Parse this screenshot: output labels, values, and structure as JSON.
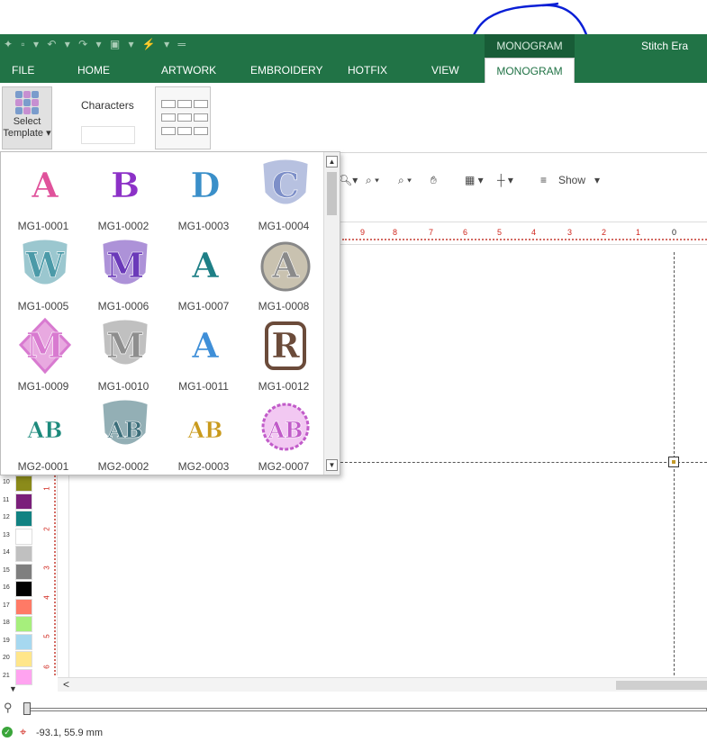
{
  "titlebar": {
    "context_title": "MONOGRAM",
    "app_title": "Stitch Era"
  },
  "tabs": [
    {
      "label": "FILE"
    },
    {
      "label": "HOME"
    },
    {
      "label": "ARTWORK"
    },
    {
      "label": "EMBROIDERY"
    },
    {
      "label": "HOTFIX"
    },
    {
      "label": "VIEW"
    },
    {
      "label": "MONOGRAM"
    }
  ],
  "ribbon": {
    "select_template_line1": "Select",
    "select_template_line2": "Template",
    "characters_label": "Characters",
    "characters_value": ""
  },
  "toolbar": {
    "show_label": "Show"
  },
  "ruler": {
    "ticks": [
      "9",
      "8",
      "7",
      "6",
      "5",
      "4",
      "3",
      "2",
      "1",
      "0"
    ]
  },
  "vruler": {
    "ticks": [
      "1",
      "2",
      "3",
      "4",
      "5",
      "6"
    ]
  },
  "gallery": {
    "items": [
      {
        "label": "MG1-0001",
        "glyph": "A",
        "color": "#e0529b"
      },
      {
        "label": "MG1-0002",
        "glyph": "B",
        "color": "#8c31c7"
      },
      {
        "label": "MG1-0003",
        "glyph": "D",
        "color": "#3a8fc9"
      },
      {
        "label": "MG1-0004",
        "glyph": "C",
        "color": "#7d8fc8"
      },
      {
        "label": "MG1-0005",
        "glyph": "W",
        "color": "#4b9aa8"
      },
      {
        "label": "MG1-0006",
        "glyph": "M",
        "color": "#6b3ab9"
      },
      {
        "label": "MG1-0007",
        "glyph": "A",
        "color": "#1e7f86"
      },
      {
        "label": "MG1-0008",
        "glyph": "A",
        "color": "#8a8a8a"
      },
      {
        "label": "MG1-0009",
        "glyph": "M",
        "color": "#d87ad0"
      },
      {
        "label": "MG1-0010",
        "glyph": "M",
        "color": "#8e8e8e"
      },
      {
        "label": "MG1-0011",
        "glyph": "A",
        "color": "#3f8fd8"
      },
      {
        "label": "MG1-0012",
        "glyph": "R",
        "color": "#6b4b3a"
      },
      {
        "label": "MG2-0001",
        "glyph": "AB",
        "color": "#1c8a7c"
      },
      {
        "label": "MG2-0002",
        "glyph": "AB",
        "color": "#3c6e7a"
      },
      {
        "label": "MG2-0003",
        "glyph": "AB",
        "color": "#c99a1c"
      },
      {
        "label": "MG2-0007",
        "glyph": "AB",
        "color": "#c15bc9"
      }
    ]
  },
  "palette": [
    {
      "num": "10",
      "color": "#8b8b1a"
    },
    {
      "num": "11",
      "color": "#7a1f7a"
    },
    {
      "num": "12",
      "color": "#128282"
    },
    {
      "num": "13",
      "color": "#ffffff"
    },
    {
      "num": "14",
      "color": "#c0c0c0"
    },
    {
      "num": "15",
      "color": "#7f7f7f"
    },
    {
      "num": "16",
      "color": "#000000"
    },
    {
      "num": "17",
      "color": "#ff7a66"
    },
    {
      "num": "18",
      "color": "#a6ef7c"
    },
    {
      "num": "19",
      "color": "#a6d8f0"
    },
    {
      "num": "20",
      "color": "#ffe68a"
    },
    {
      "num": "21",
      "color": "#ffa3f0"
    }
  ],
  "status": {
    "coordinates": "-93.1, 55.9 mm"
  }
}
